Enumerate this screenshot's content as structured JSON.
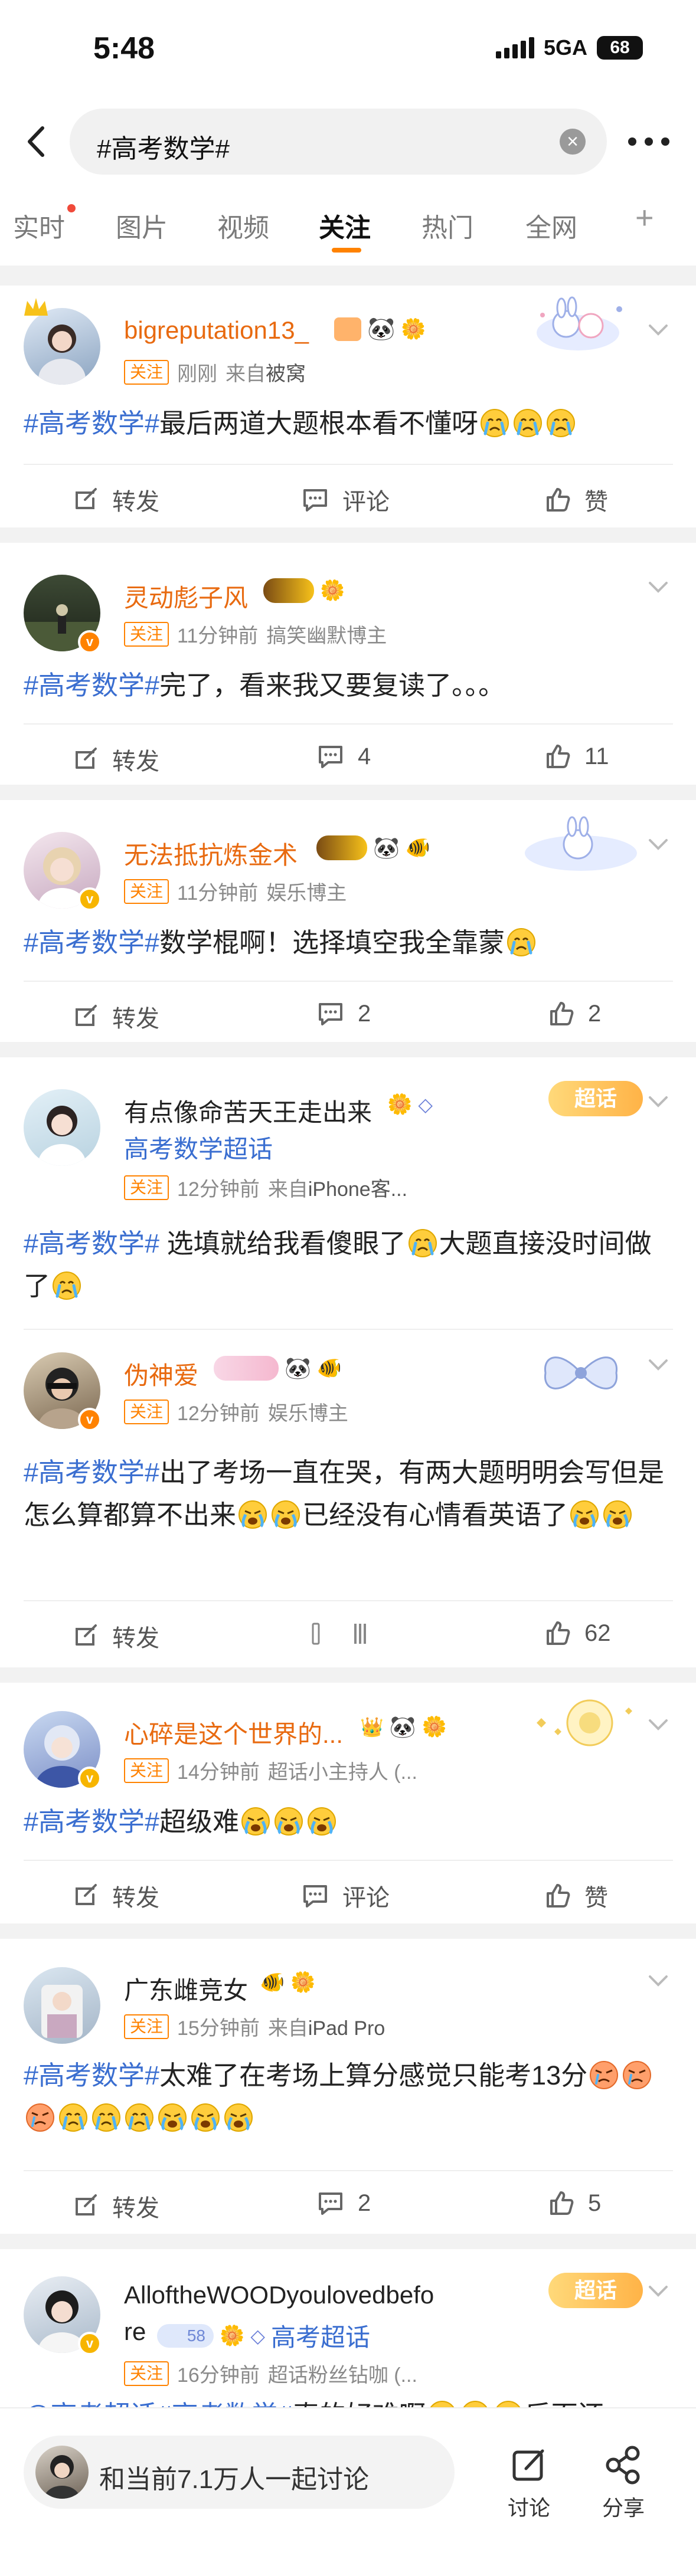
{
  "status_bar": {
    "time": "5:48",
    "network": "5GA",
    "battery": "68"
  },
  "search": {
    "query": "#高考数学#"
  },
  "tabs": [
    {
      "label": "实时",
      "has_dot": true
    },
    {
      "label": "图片"
    },
    {
      "label": "视频"
    },
    {
      "label": "关注",
      "active": true
    },
    {
      "label": "热门"
    },
    {
      "label": "全网"
    },
    {
      "label": "+"
    }
  ],
  "posts": [
    {
      "username": "bigreputation13_",
      "follow": "关注",
      "time": "刚刚",
      "source_prefix": "来自",
      "source": "被窝",
      "tag": "#高考数学#",
      "text": "最后两道大题根本看不懂呀",
      "actions": {
        "repost": "转发",
        "comment": "评论",
        "like": "赞"
      }
    },
    {
      "username": "灵动彪子风",
      "follow": "关注",
      "time": "11分钟前",
      "source": "搞笑幽默博主",
      "tag": "#高考数学#",
      "text": "完了，看来我又要复读了。。。",
      "actions": {
        "repost": "转发",
        "comment": "4",
        "like": "11"
      }
    },
    {
      "username": "无法抵抗炼金术",
      "follow": "关注",
      "time": "11分钟前",
      "source": "娱乐博主",
      "tag": "#高考数学#",
      "text": "数学棍啊！选择填空我全靠蒙",
      "actions": {
        "repost": "转发",
        "comment": "2",
        "like": "2"
      }
    },
    {
      "username": "有点像命苦天王走出来",
      "supertopic": "高考数学超话",
      "follow": "关注",
      "time": "12分钟前",
      "source_prefix": "来自",
      "source": "iPhone客...",
      "deco_label": "超话",
      "tag": "#高考数学#",
      "text": " 选填就给我看傻眼了",
      "text2": "大题直接没时间做了"
    },
    {
      "username": "伪神爱",
      "follow": "关注",
      "time": "12分钟前",
      "source": "娱乐博主",
      "tag": "#高考数学#",
      "text": "出了考场一直在哭，有两大题明明会写但是怎么算都算不出来",
      "text2": "已经没有心情看英语了",
      "actions": {
        "repost": "转发",
        "like": "62"
      }
    },
    {
      "username": "心碎是这个世界的...",
      "follow": "关注",
      "time": "14分钟前",
      "source": "超话小主持人 (...",
      "tag": "#高考数学#",
      "text": "超级难",
      "actions": {
        "repost": "转发",
        "comment": "评论",
        "like": "赞"
      }
    },
    {
      "username": "广东雌竞女",
      "follow": "关注",
      "time": "15分钟前",
      "source_prefix": "来自",
      "source": "iPad Pro",
      "tag": "#高考数学#",
      "text": "太难了在考场上算分感觉只能考13分",
      "actions": {
        "repost": "转发",
        "comment": "2",
        "like": "5"
      }
    },
    {
      "username": "AlloftheWOODyoulovedbefore",
      "username_line1": "AlloftheWOODyoulovedbefo",
      "username_line2": "re",
      "level_badge": "58",
      "supertopic": "高考超话",
      "deco_label": "超话",
      "follow": "关注",
      "time": "16分钟前",
      "source": "超话粉丝钻咖 (...",
      "tag": "@高考超话#高考数学#",
      "text": "真的好难啊",
      "text2": "后面还"
    }
  ],
  "bottom_bar": {
    "discuss_text": "和当前7.1万人一起讨论",
    "comment_label": "讨论",
    "share_label": "分享"
  },
  "colors": {
    "accent": "#ff8200",
    "link": "#3a6ed0",
    "username": "#e86a10"
  }
}
